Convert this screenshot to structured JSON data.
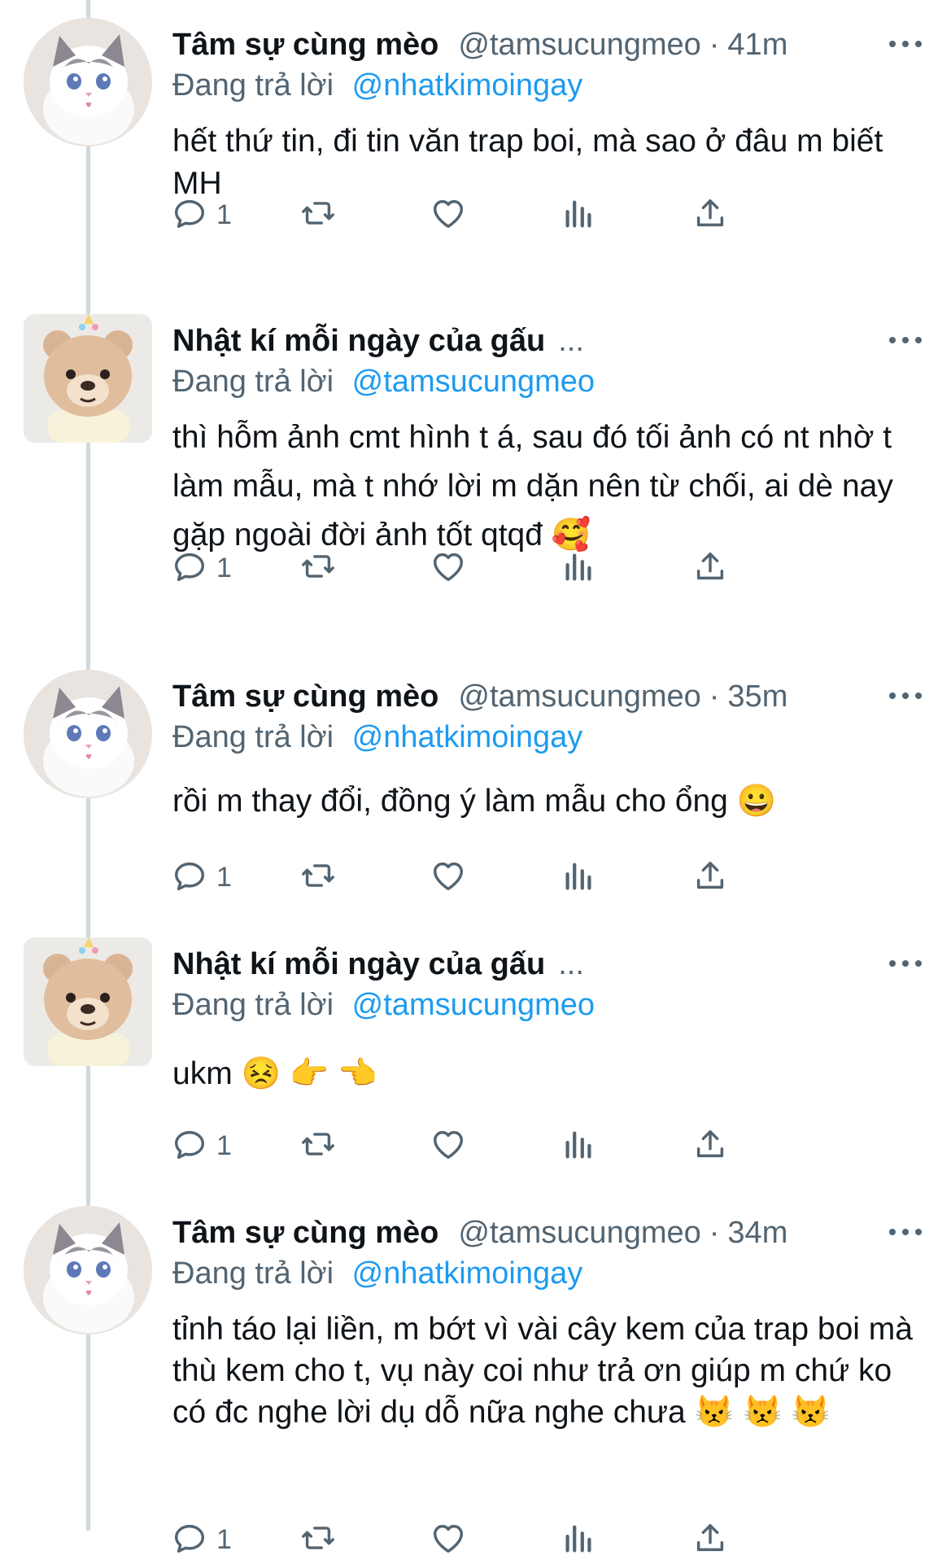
{
  "thread": [
    {
      "display_name": "Tâm sự cùng mèo",
      "handle": "@tamsucungmeo",
      "separator": "·",
      "time": "41m",
      "truncated": "",
      "reply_label": "Đang trả lời",
      "reply_to": "@nhatkimoingay",
      "text": "hết thứ tin, đi tin văn trap boi, mà sao ở đâu m biết MH",
      "reply_count": "1",
      "avatar_icon": "cat-avatar"
    },
    {
      "display_name": "Nhật kí mỗi ngày của gấu",
      "handle": "",
      "separator": "",
      "time": "",
      "truncated": "...",
      "reply_label": "Đang trả lời",
      "reply_to": "@tamsucungmeo",
      "text": "thì hỗm ảnh cmt hình t á, sau đó tối ảnh có nt nhờ t làm mẫu, mà t nhớ lời m dặn nên từ chối, ai dè nay gặp ngoài đời ảnh tốt qtqđ 🥰",
      "reply_count": "1",
      "avatar_icon": "bear-avatar"
    },
    {
      "display_name": "Tâm sự cùng mèo",
      "handle": "@tamsucungmeo",
      "separator": "·",
      "time": "35m",
      "truncated": "",
      "reply_label": "Đang trả lời",
      "reply_to": "@nhatkimoingay",
      "text": "rồi m thay đổi, đồng ý làm mẫu cho ổng 😀",
      "reply_count": "1",
      "avatar_icon": "cat-avatar"
    },
    {
      "display_name": "Nhật kí mỗi ngày của gấu",
      "handle": "",
      "separator": "",
      "time": "",
      "truncated": "...",
      "reply_label": "Đang trả lời",
      "reply_to": "@tamsucungmeo",
      "text": "ukm 😣 👉 👈",
      "reply_count": "1",
      "avatar_icon": "bear-avatar"
    },
    {
      "display_name": "Tâm sự cùng mèo",
      "handle": "@tamsucungmeo",
      "separator": "·",
      "time": "34m",
      "truncated": "",
      "reply_label": "Đang trả lời",
      "reply_to": "@nhatkimoingay",
      "text": "tỉnh táo lại liền, m bớt vì vài cây kem của trap boi mà thù kem cho t, vụ này coi như trả ơn giúp m chứ ko có đc nghe lời dụ dỗ nữa nghe chưa 😾 😾 😾",
      "reply_count": "1",
      "avatar_icon": "cat-avatar"
    }
  ],
  "action_icons": [
    "reply-icon",
    "retweet-icon",
    "like-icon",
    "views-icon",
    "share-icon"
  ],
  "colors": {
    "text": "#0f1419",
    "muted": "#536471",
    "link": "#1d9bf0",
    "thread_line": "#cfd9de"
  }
}
